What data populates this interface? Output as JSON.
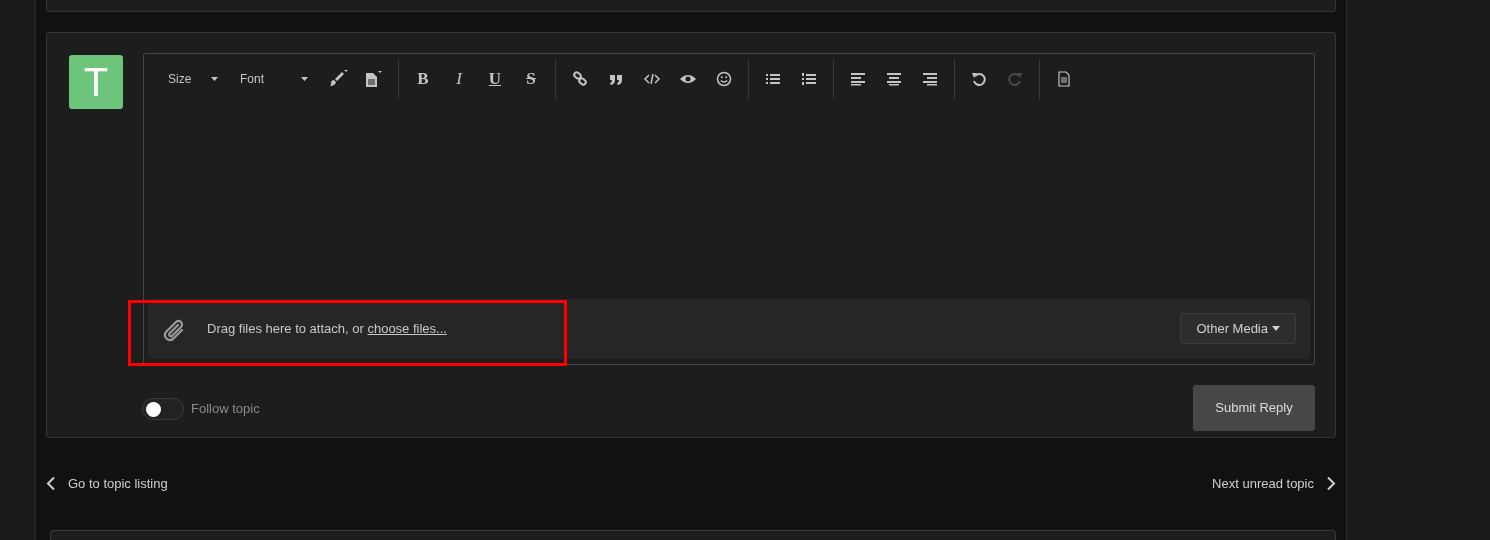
{
  "avatar": {
    "letter": "T",
    "color": "#6cc57a"
  },
  "toolbar": [
    {
      "kind": "size",
      "label": "Size"
    },
    {
      "kind": "font",
      "label": "Font"
    },
    {
      "kind": "brush"
    },
    {
      "kind": "paste"
    },
    {
      "kind": "separator"
    },
    {
      "kind": "bold",
      "label": "B"
    },
    {
      "kind": "italic",
      "label": "I"
    },
    {
      "kind": "underline",
      "label": "U"
    },
    {
      "kind": "strike",
      "label": "S"
    },
    {
      "kind": "separator"
    },
    {
      "kind": "link"
    },
    {
      "kind": "quote"
    },
    {
      "kind": "code"
    },
    {
      "kind": "eye"
    },
    {
      "kind": "smile"
    },
    {
      "kind": "separator"
    },
    {
      "kind": "bullets"
    },
    {
      "kind": "numbers"
    },
    {
      "kind": "separator"
    },
    {
      "kind": "align-left"
    },
    {
      "kind": "align-center"
    },
    {
      "kind": "align-right"
    },
    {
      "kind": "separator"
    },
    {
      "kind": "undo",
      "disabled": false
    },
    {
      "kind": "redo",
      "disabled": true
    },
    {
      "kind": "separator"
    },
    {
      "kind": "source"
    }
  ],
  "attach": {
    "text": "Drag files here to attach, or ",
    "link": "choose files...",
    "menu": "Other Media"
  },
  "follow": {
    "label": "Follow topic",
    "on": false
  },
  "submit": "Submit Reply",
  "nav": {
    "prev": "Go to topic listing",
    "next": "Next unread topic"
  }
}
